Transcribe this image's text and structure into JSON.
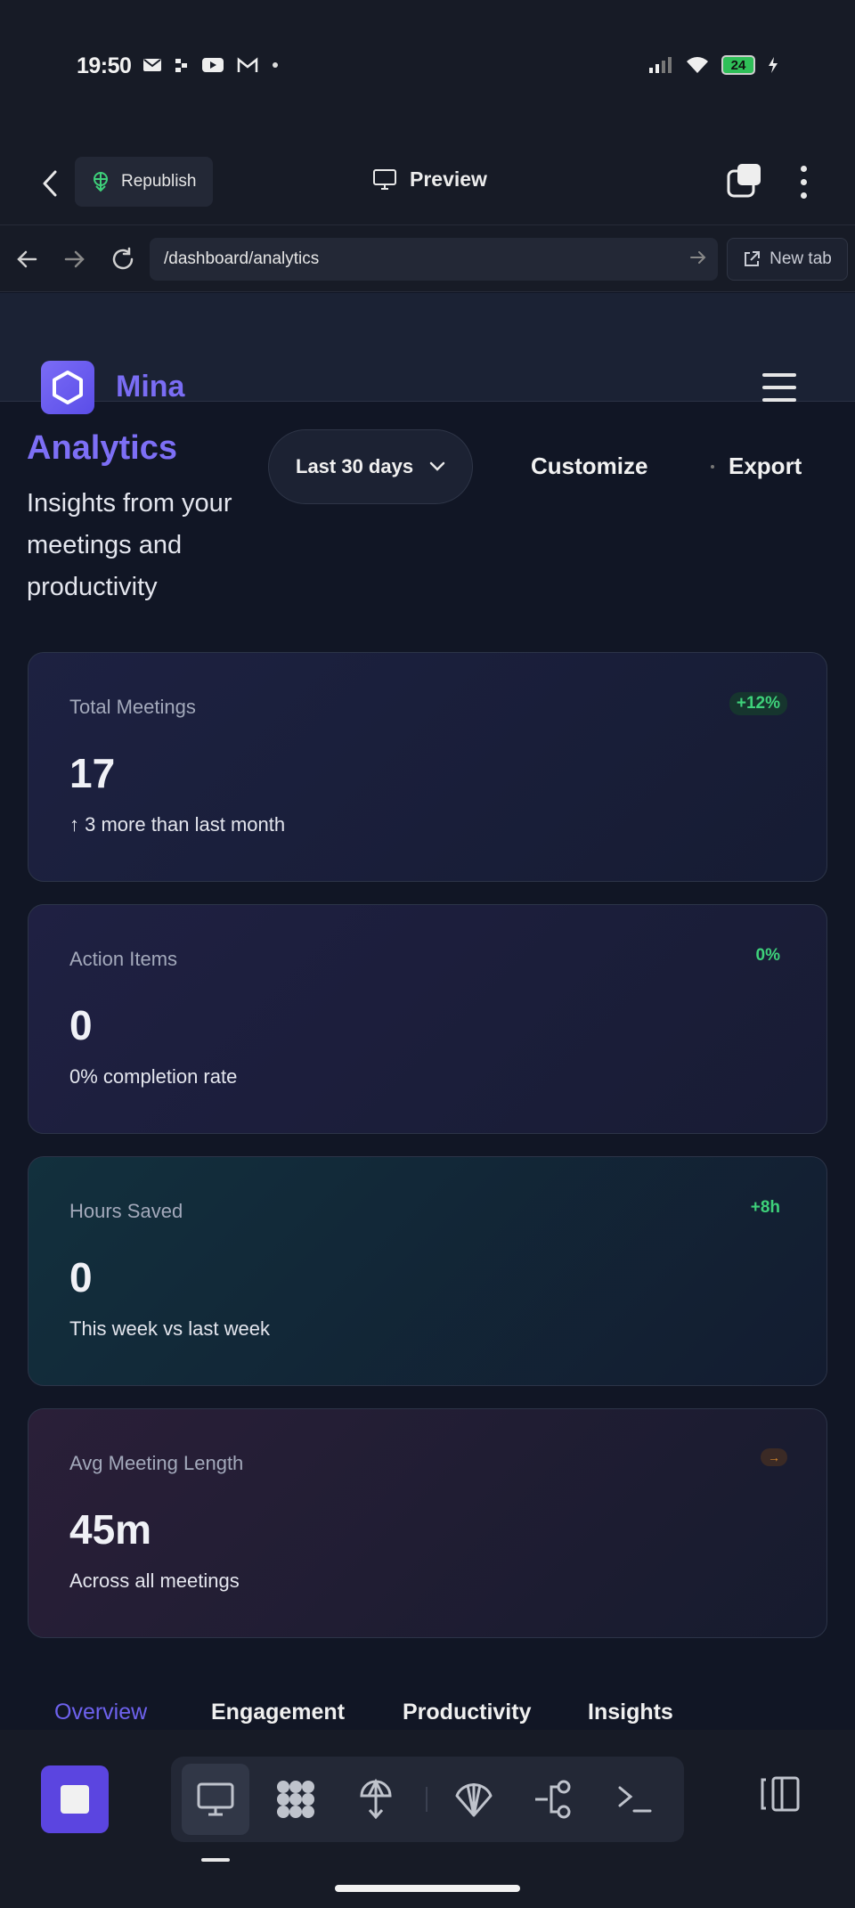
{
  "status_bar": {
    "time": "19:50",
    "notification_icons": [
      "mail-icon",
      "dots-icon",
      "youtube-icon",
      "gmail-icon",
      "dot-icon"
    ],
    "system_icons": [
      "signal-icon",
      "wifi-icon",
      "battery-icon",
      "charging-icon"
    ],
    "battery_level": "24"
  },
  "app_bar": {
    "republish_label": "Republish",
    "preview_label": "Preview"
  },
  "url_bar": {
    "url": "/dashboard/analytics",
    "new_tab_label": "New tab"
  },
  "site_header": {
    "brand": "Mina"
  },
  "page": {
    "title": "Analytics",
    "subtitle": "Insights from your meetings and productivity",
    "range_selected": "Last 30 days",
    "customize_label": "Customize",
    "export_label": "Export"
  },
  "cards": [
    {
      "label": "Total Meetings",
      "badge": "+12%",
      "value": "17",
      "note": "↑ 3 more than last month"
    },
    {
      "label": "Action Items",
      "badge": "0%",
      "value": "0",
      "note": "0% completion rate"
    },
    {
      "label": "Hours Saved",
      "badge": "+8h",
      "value": "0",
      "note": "This week vs last week"
    },
    {
      "label": "Avg Meeting Length",
      "badge": "→",
      "value": "45m",
      "note": "Across all meetings"
    }
  ],
  "tabs": [
    {
      "label": "Overview",
      "active": true
    },
    {
      "label": "Engagement",
      "active": false
    },
    {
      "label": "Productivity",
      "active": false
    },
    {
      "label": "Insights",
      "active": false
    }
  ],
  "bottom_toolbar": {
    "tools": [
      "monitor-icon",
      "grid-blob-icon",
      "umbrella-icon",
      "shell-icon",
      "branch-icon",
      "terminal-icon"
    ],
    "active_tool": "monitor-icon"
  },
  "colors": {
    "accent": "#7a6df4",
    "positive": "#3ed17a",
    "warning": "#d98a2b",
    "background": "#111625"
  }
}
